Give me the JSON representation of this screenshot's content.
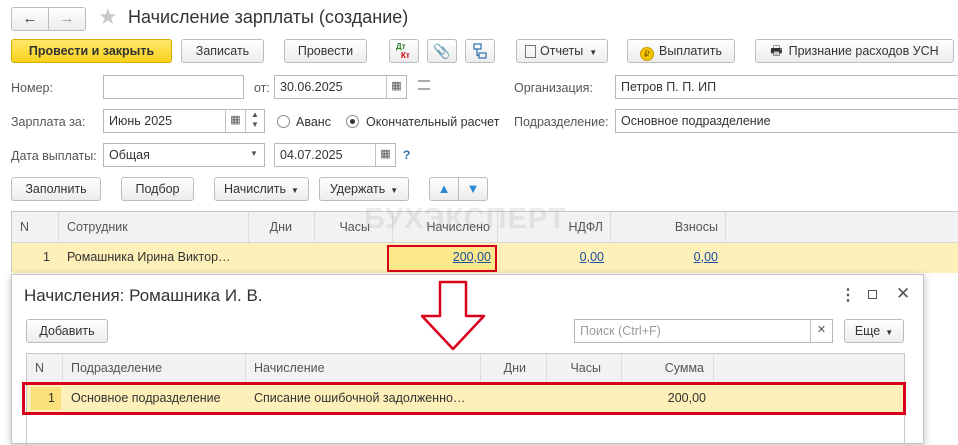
{
  "title": "Начисление зарплаты (создание)",
  "toolbar": {
    "post_close": "Провести и закрыть",
    "save": "Записать",
    "post": "Провести",
    "dtkt_top": "Дт",
    "dtkt_bottom": "Кт",
    "reports": "Отчеты",
    "pay": "Выплатить",
    "usn": "Признание расходов УСН"
  },
  "form": {
    "number_label": "Номер:",
    "number_value": "",
    "date_label": "от:",
    "date_value": "30.06.2025",
    "org_label": "Организация:",
    "org_value": "Петров П. П. ИП",
    "salary_for_label": "Зарплата за:",
    "salary_for_value": "Июнь 2025",
    "advance_label": "Аванс",
    "final_label": "Окончательный расчет",
    "dept_label": "Подразделение:",
    "dept_value": "Основное подразделение",
    "pay_date_label": "Дата выплаты:",
    "pay_type_value": "Общая",
    "pay_date_value": "04.07.2025",
    "help": "?"
  },
  "actions": {
    "fill": "Заполнить",
    "select": "Подбор",
    "accrue": "Начислить",
    "withhold": "Удержать"
  },
  "table": {
    "columns": [
      "N",
      "Сотрудник",
      "Дни",
      "Часы",
      "Начислено",
      "НДФЛ",
      "Взносы"
    ],
    "rows": [
      {
        "n": "1",
        "employee": "Ромашника Ирина Виктор…",
        "days": "",
        "hours": "",
        "accrued": "200,00",
        "ndfl": "0,00",
        "contrib": "0,00"
      }
    ]
  },
  "watermark": "БУХЭКСПЕРТ",
  "dialog": {
    "title": "Начисления: Ромашника И. В.",
    "add": "Добавить",
    "search_placeholder": "Поиск (Ctrl+F)",
    "more": "Еще",
    "columns": [
      "N",
      "Подразделение",
      "Начисление",
      "Дни",
      "Часы",
      "Сумма"
    ],
    "rows": [
      {
        "n": "1",
        "dept": "Основное подразделение",
        "accrual": "Списание ошибочной задолженно…",
        "days": "",
        "hours": "",
        "sum": "200,00"
      }
    ]
  },
  "colors": {
    "accent_red": "#d9001b",
    "selection": "#fdf0b8",
    "yellow_button": "#f8d21c"
  }
}
